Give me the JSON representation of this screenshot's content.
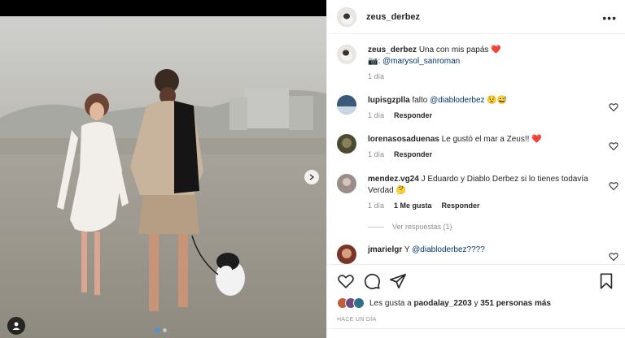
{
  "post": {
    "author": "zeus_derbez",
    "caption": "Una con mis papás",
    "caption_emoji": "❤️",
    "photo_credit": "@marysol_sanroman",
    "caption_time": "1 día"
  },
  "comments": [
    {
      "user": "lupisgzplla",
      "text": "falto",
      "mention": "@diabloderbez",
      "emoji": "😟😅",
      "time": "1 día",
      "reply_label": "Responder"
    },
    {
      "user": "lorenasosaduenas",
      "text": "Le gustó el mar a Zeus!!",
      "emoji": "❤️",
      "time": "1 día",
      "reply_label": "Responder"
    },
    {
      "user": "mendez.vg24",
      "text": "J Eduardo y Diablo Derbez si lo tienes todavía Verdad",
      "emoji": "🤔",
      "time": "1 día",
      "likes_label": "1 Me gusta",
      "reply_label": "Responder",
      "view_replies": "Ver respuestas (1)"
    },
    {
      "user": "jmarielgr",
      "text": "Y",
      "mention": "@diabloderbez????"
    }
  ],
  "likes": {
    "prefix": "Les gusta a",
    "user": "paodalay_2203",
    "joiner": "y",
    "others": "351 personas más"
  },
  "timestamp": "HACE UN DÍA",
  "icons": [
    "more-icon",
    "heart-icon",
    "comment-icon",
    "share-icon",
    "save-icon",
    "next-arrow-icon",
    "user-tag-icon"
  ],
  "colors": {
    "link": "#00376b",
    "muted": "#8e8e8e",
    "dot_active": "#3897f0",
    "heart": "#ed4956"
  }
}
